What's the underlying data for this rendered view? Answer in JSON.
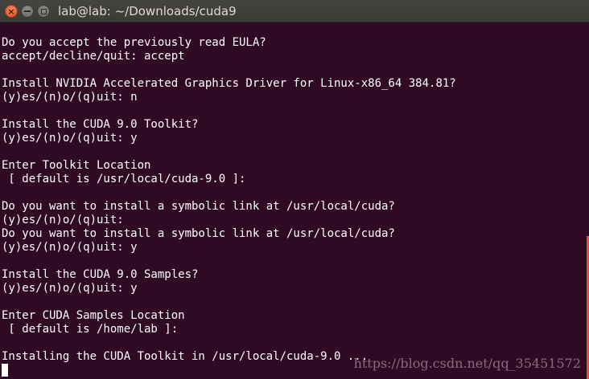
{
  "window": {
    "title": "lab@lab: ~/Downloads/cuda9"
  },
  "terminal": {
    "lines": [
      "Do you accept the previously read EULA?",
      "accept/decline/quit: accept",
      "",
      "Install NVIDIA Accelerated Graphics Driver for Linux-x86_64 384.81?",
      "(y)es/(n)o/(q)uit: n",
      "",
      "Install the CUDA 9.0 Toolkit?",
      "(y)es/(n)o/(q)uit: y",
      "",
      "Enter Toolkit Location",
      " [ default is /usr/local/cuda-9.0 ]:",
      "",
      "Do you want to install a symbolic link at /usr/local/cuda?",
      "(y)es/(n)o/(q)uit:",
      "Do you want to install a symbolic link at /usr/local/cuda?",
      "(y)es/(n)o/(q)uit: y",
      "",
      "Install the CUDA 9.0 Samples?",
      "(y)es/(n)o/(q)uit: y",
      "",
      "Enter CUDA Samples Location",
      " [ default is /home/lab ]:",
      "",
      "Installing the CUDA Toolkit in /usr/local/cuda-9.0 ..."
    ]
  },
  "scrollbar": {
    "position_fraction": 0.6,
    "thumb_fraction": 0.4
  },
  "watermark": "https://blog.csdn.net/qq_35451572",
  "colors": {
    "background": "#300a24",
    "foreground": "#ffffff",
    "accent": "#e95420",
    "titlebar": "#3c3b37"
  },
  "icons": {
    "close": "close-icon",
    "minimize": "minimize-icon",
    "maximize": "maximize-icon"
  }
}
